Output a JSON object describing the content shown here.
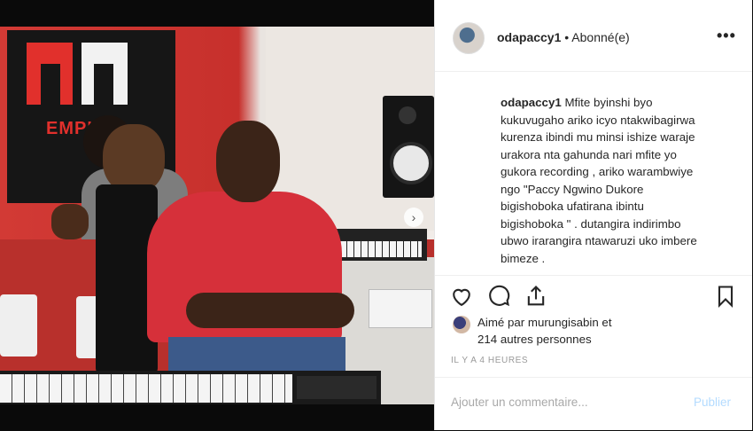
{
  "photo": {
    "brand_text": "EMPIRE",
    "nav_arrow": "›"
  },
  "header": {
    "username": "odapaccy1",
    "separator": " • ",
    "follow_status": "Abonné(e)",
    "more_label": "•••"
  },
  "caption": {
    "author": "odapaccy1",
    "lines": [
      " Mfite byinshi byo",
      "kukuvugaho ariko icyo ntakwibagirwa",
      "kurenza ibindi mu minsi ishize waraje",
      "urakora nta gahunda nari mfite yo",
      "gukora recording , ariko warambwiye",
      "ngo \"Paccy Ngwino Dukore",
      "bigishoboka ufatirana ibintu",
      "bigishoboka \" . dutangira indirimbo",
      "ubwo irarangira ntawaruzi uko imbere",
      "bimeze ."
    ]
  },
  "actions": {
    "like": "heart-icon",
    "comment": "comment-icon",
    "share": "share-icon",
    "save": "bookmark-icon"
  },
  "likes": {
    "prefix": "Aimé par ",
    "user": "murungisabin",
    "suffix": " et",
    "line2": "214 autres personnes"
  },
  "timestamp": "IL Y A 4 HEURES",
  "comment": {
    "placeholder": "Ajouter un commentaire...",
    "publish_label": "Publier",
    "publish_color": "#b3dbff"
  }
}
